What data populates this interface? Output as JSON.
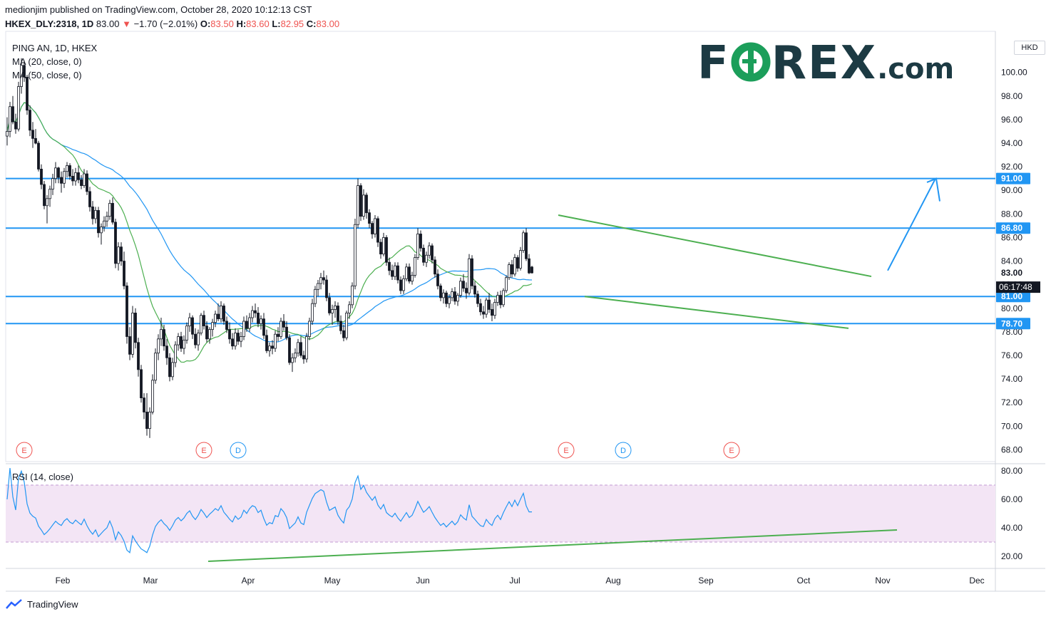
{
  "header": {
    "line1": "medionjim published on TradingView.com, October 28, 2020 10:12:13 CST",
    "symbol": "HKEX_DLY:2318, 1D",
    "price": "83.00",
    "change_arrow": "▼",
    "change": "−1.70 (−2.01%)",
    "o_label": "O:",
    "o_value": "83.50",
    "h_label": "H:",
    "h_value": "83.60",
    "l_label": "L:",
    "l_value": "82.95",
    "c_label": "C:",
    "c_value": "83.00"
  },
  "legend": {
    "title": "PING AN, 1D, HKEX",
    "ma20": "MA (20, close, 0)",
    "ma50": "MA (50, close, 0)",
    "rsi": "RSI (14, close)"
  },
  "logo": {
    "part1": "F",
    "part2": "REX",
    "part3": ".com"
  },
  "currency": "HKD",
  "footer": {
    "brand": "TradingView"
  },
  "colors": {
    "up": "#ffffff",
    "down": "#131722",
    "ma20": "#4caf50",
    "ma50": "#2196f3",
    "hlines": "#2196f3",
    "trend": "#4caf50",
    "rsi": "#2196f3",
    "rsi_band": "#f3e5f5",
    "header_down": "#ef5350",
    "logo": "#1c3a43",
    "logo_o": "#1b9e5a"
  },
  "chart_data": {
    "type": "candlestick",
    "x_ticks": [
      "Feb",
      "Mar",
      "Apr",
      "May",
      "Jun",
      "Jul",
      "Aug",
      "Sep",
      "Oct",
      "Nov",
      "Dec"
    ],
    "y_ticks": [
      "68.00",
      "70.00",
      "72.00",
      "74.00",
      "76.00",
      "78.00",
      "80.00",
      "82.00",
      "84.00",
      "86.00",
      "88.00",
      "90.00",
      "92.00",
      "94.00",
      "96.00",
      "98.00",
      "100.00"
    ],
    "y_range": [
      67,
      103
    ],
    "price_labels": [
      {
        "value": 91.0,
        "text": "91.00",
        "kind": "level"
      },
      {
        "value": 86.8,
        "text": "86.80",
        "kind": "level"
      },
      {
        "value": 83.0,
        "text": "83.00",
        "kind": "last"
      },
      {
        "value": 81.0,
        "text": "81.00",
        "kind": "level"
      },
      {
        "value": 78.7,
        "text": "78.70",
        "kind": "level"
      }
    ],
    "countdown": "06:17:48",
    "horizontal_levels": [
      91.0,
      86.8,
      81.0,
      78.7
    ],
    "events": [
      {
        "label": "E",
        "date_index": 37
      },
      {
        "label": "E",
        "date_index": 100
      },
      {
        "label": "D",
        "date_index": 112
      },
      {
        "label": "E",
        "date_index": 227
      },
      {
        "label": "D",
        "date_index": 247
      },
      {
        "label": "E",
        "date_index": 285
      }
    ],
    "rsi": {
      "y_ticks": [
        "20.00",
        "40.00",
        "60.00",
        "80.00"
      ],
      "y_range": [
        13,
        83
      ],
      "overbought": 70,
      "oversold": 30
    },
    "candles_ohlc_daily": [
      [
        94.6,
        96.2,
        93.8,
        95.0
      ],
      [
        95.0,
        97.5,
        94.5,
        97.1
      ],
      [
        97.1,
        98.0,
        95.6,
        95.8
      ],
      [
        95.8,
        96.5,
        94.8,
        95.2
      ],
      [
        95.2,
        99.2,
        95.0,
        98.8
      ],
      [
        98.8,
        101.2,
        98.2,
        100.6
      ],
      [
        100.6,
        101.0,
        99.2,
        99.6
      ],
      [
        99.6,
        99.8,
        96.4,
        96.8
      ],
      [
        96.8,
        97.2,
        94.6,
        95.1
      ],
      [
        95.1,
        95.8,
        93.6,
        94.4
      ],
      [
        94.4,
        95.2,
        93.9,
        94.0
      ],
      [
        94.0,
        94.2,
        91.6,
        91.8
      ],
      [
        91.8,
        92.2,
        90.1,
        90.5
      ],
      [
        90.5,
        90.8,
        88.4,
        88.7
      ],
      [
        88.7,
        89.6,
        87.2,
        89.3
      ],
      [
        89.3,
        90.4,
        88.6,
        90.1
      ],
      [
        90.1,
        91.4,
        89.6,
        91.0
      ],
      [
        91.0,
        92.4,
        90.6,
        91.9
      ],
      [
        91.9,
        92.0,
        90.6,
        91.1
      ],
      [
        91.1,
        91.6,
        89.8,
        90.6
      ],
      [
        90.6,
        91.9,
        90.2,
        91.6
      ],
      [
        91.6,
        92.4,
        91.1,
        92.1
      ],
      [
        92.1,
        92.3,
        90.9,
        91.2
      ],
      [
        91.2,
        91.8,
        90.4,
        90.8
      ],
      [
        90.8,
        91.9,
        90.4,
        91.5
      ],
      [
        91.5,
        92.1,
        90.6,
        90.9
      ],
      [
        90.9,
        91.3,
        90.1,
        90.4
      ],
      [
        90.4,
        91.8,
        90.2,
        91.4
      ],
      [
        91.4,
        91.7,
        89.6,
        89.9
      ],
      [
        89.9,
        90.3,
        88.2,
        88.6
      ],
      [
        88.6,
        89.1,
        87.1,
        87.6
      ],
      [
        87.6,
        88.6,
        87.2,
        88.3
      ],
      [
        88.3,
        88.6,
        86.0,
        86.4
      ],
      [
        86.4,
        87.2,
        85.4,
        86.9
      ],
      [
        86.9,
        87.8,
        86.5,
        87.4
      ],
      [
        87.4,
        88.2,
        86.9,
        87.8
      ],
      [
        87.8,
        89.2,
        87.5,
        88.9
      ],
      [
        88.9,
        89.4,
        87.1,
        87.3
      ],
      [
        87.3,
        87.6,
        83.4,
        83.8
      ],
      [
        83.8,
        85.6,
        83.2,
        85.2
      ],
      [
        85.2,
        85.6,
        83.6,
        84.0
      ],
      [
        84.0,
        84.8,
        81.6,
        81.9
      ],
      [
        81.9,
        82.2,
        77.0,
        77.6
      ],
      [
        77.6,
        78.4,
        75.6,
        76.1
      ],
      [
        76.1,
        80.2,
        75.8,
        79.6
      ],
      [
        79.6,
        80.0,
        76.6,
        77.1
      ],
      [
        77.1,
        77.5,
        74.2,
        74.8
      ],
      [
        74.8,
        75.2,
        72.0,
        72.4
      ],
      [
        72.4,
        72.8,
        70.6,
        71.2
      ],
      [
        71.2,
        72.8,
        69.2,
        69.8
      ],
      [
        69.8,
        71.6,
        69.0,
        71.2
      ],
      [
        71.2,
        74.4,
        71.0,
        73.9
      ],
      [
        73.9,
        76.6,
        73.6,
        76.2
      ],
      [
        76.2,
        77.8,
        75.6,
        77.4
      ],
      [
        77.4,
        79.2,
        76.8,
        78.2
      ],
      [
        78.2,
        78.6,
        76.4,
        76.8
      ],
      [
        76.8,
        77.4,
        75.2,
        75.8
      ],
      [
        75.8,
        76.2,
        73.8,
        74.2
      ],
      [
        74.2,
        75.8,
        73.9,
        75.4
      ],
      [
        75.4,
        77.2,
        75.0,
        76.9
      ],
      [
        76.9,
        77.9,
        76.4,
        77.6
      ],
      [
        77.6,
        78.0,
        76.3,
        76.6
      ],
      [
        76.6,
        77.7,
        76.1,
        77.3
      ],
      [
        77.3,
        78.8,
        77.0,
        78.5
      ],
      [
        78.5,
        79.6,
        78.0,
        79.2
      ],
      [
        79.2,
        79.4,
        77.4,
        77.8
      ],
      [
        77.8,
        78.3,
        76.6,
        76.9
      ],
      [
        76.9,
        78.2,
        76.4,
        77.9
      ],
      [
        77.9,
        79.6,
        77.7,
        79.4
      ],
      [
        79.4,
        79.8,
        78.2,
        78.5
      ],
      [
        78.5,
        78.9,
        77.1,
        77.4
      ],
      [
        77.4,
        78.4,
        77.0,
        78.2
      ],
      [
        78.2,
        79.1,
        77.6,
        78.8
      ],
      [
        78.8,
        79.8,
        78.4,
        79.5
      ],
      [
        79.5,
        80.4,
        78.9,
        79.1
      ],
      [
        79.1,
        80.6,
        78.8,
        80.2
      ],
      [
        80.2,
        80.4,
        78.6,
        78.9
      ],
      [
        78.9,
        79.3,
        77.9,
        78.2
      ],
      [
        78.2,
        78.8,
        77.0,
        77.4
      ],
      [
        77.4,
        77.9,
        76.5,
        76.8
      ],
      [
        76.8,
        78.3,
        76.5,
        77.9
      ],
      [
        77.9,
        78.2,
        76.9,
        77.2
      ],
      [
        77.2,
        78.0,
        76.7,
        77.6
      ],
      [
        77.6,
        79.3,
        77.3,
        78.9
      ],
      [
        78.9,
        79.4,
        78.0,
        78.3
      ],
      [
        78.3,
        79.6,
        78.0,
        79.2
      ],
      [
        79.2,
        80.2,
        78.8,
        79.8
      ],
      [
        79.8,
        80.4,
        79.2,
        79.6
      ],
      [
        79.6,
        80.1,
        78.4,
        78.7
      ],
      [
        78.7,
        79.4,
        78.2,
        79.1
      ],
      [
        79.1,
        79.6,
        77.4,
        77.7
      ],
      [
        77.7,
        78.2,
        76.2,
        76.4
      ],
      [
        76.4,
        77.1,
        75.9,
        76.8
      ],
      [
        76.8,
        77.3,
        76.1,
        76.6
      ],
      [
        76.6,
        78.1,
        76.3,
        77.8
      ],
      [
        77.8,
        78.4,
        77.2,
        77.6
      ],
      [
        77.6,
        79.2,
        77.4,
        78.9
      ],
      [
        78.9,
        79.5,
        78.1,
        78.4
      ],
      [
        78.4,
        78.9,
        77.3,
        77.5
      ],
      [
        77.5,
        77.8,
        75.2,
        75.4
      ],
      [
        75.4,
        76.2,
        74.6,
        75.8
      ],
      [
        75.8,
        76.6,
        75.4,
        76.2
      ],
      [
        76.2,
        77.4,
        75.9,
        77.1
      ],
      [
        77.1,
        77.6,
        75.8,
        76.0
      ],
      [
        76.0,
        76.4,
        75.3,
        75.7
      ],
      [
        75.7,
        77.9,
        75.4,
        77.6
      ],
      [
        77.6,
        79.2,
        77.3,
        78.9
      ],
      [
        78.9,
        80.8,
        78.6,
        80.4
      ],
      [
        80.4,
        81.9,
        80.1,
        81.6
      ],
      [
        81.6,
        82.4,
        81.0,
        82.1
      ],
      [
        82.1,
        83.0,
        81.6,
        82.6
      ],
      [
        82.6,
        83.2,
        82.0,
        82.4
      ],
      [
        82.4,
        82.8,
        80.6,
        80.9
      ],
      [
        80.9,
        81.3,
        79.4,
        79.6
      ],
      [
        79.6,
        80.3,
        78.6,
        79.9
      ],
      [
        79.9,
        80.6,
        79.2,
        80.2
      ],
      [
        80.2,
        80.5,
        78.6,
        78.9
      ],
      [
        78.9,
        79.4,
        77.8,
        78.1
      ],
      [
        78.1,
        78.6,
        77.2,
        77.5
      ],
      [
        77.5,
        79.8,
        77.3,
        79.6
      ],
      [
        79.6,
        80.6,
        79.1,
        80.3
      ],
      [
        80.3,
        82.2,
        80.0,
        81.9
      ],
      [
        81.9,
        87.6,
        81.6,
        87.1
      ],
      [
        87.1,
        91.0,
        86.8,
        90.4
      ],
      [
        90.4,
        90.6,
        87.4,
        87.8
      ],
      [
        87.8,
        90.1,
        87.5,
        89.6
      ],
      [
        89.6,
        89.8,
        87.6,
        88.1
      ],
      [
        88.1,
        88.4,
        86.8,
        87.2
      ],
      [
        87.2,
        87.4,
        85.9,
        86.3
      ],
      [
        86.3,
        87.9,
        86.0,
        87.6
      ],
      [
        87.6,
        87.8,
        85.2,
        85.6
      ],
      [
        85.6,
        85.9,
        84.2,
        84.6
      ],
      [
        84.6,
        86.4,
        84.4,
        86.0
      ],
      [
        86.0,
        86.2,
        83.6,
        83.9
      ],
      [
        83.9,
        84.3,
        82.8,
        83.2
      ],
      [
        83.2,
        83.7,
        82.4,
        82.7
      ],
      [
        82.7,
        83.9,
        82.4,
        83.6
      ],
      [
        83.6,
        83.9,
        82.1,
        82.4
      ],
      [
        82.4,
        82.7,
        81.2,
        81.5
      ],
      [
        81.5,
        82.8,
        81.2,
        82.5
      ],
      [
        82.5,
        83.8,
        82.3,
        83.5
      ],
      [
        83.5,
        83.8,
        82.1,
        82.3
      ],
      [
        82.3,
        83.1,
        82.0,
        82.8
      ],
      [
        82.8,
        84.6,
        82.6,
        84.3
      ],
      [
        84.3,
        86.8,
        84.1,
        86.3
      ],
      [
        86.3,
        86.6,
        84.8,
        85.1
      ],
      [
        85.1,
        85.4,
        83.6,
        83.9
      ],
      [
        83.9,
        84.8,
        83.5,
        84.5
      ],
      [
        84.5,
        85.6,
        84.2,
        85.3
      ],
      [
        85.3,
        85.5,
        83.8,
        84.1
      ],
      [
        84.1,
        84.4,
        82.6,
        82.9
      ],
      [
        82.9,
        83.3,
        81.6,
        81.9
      ],
      [
        81.9,
        82.1,
        80.6,
        80.9
      ],
      [
        80.9,
        81.6,
        80.4,
        81.3
      ],
      [
        81.3,
        81.5,
        80.1,
        80.4
      ],
      [
        80.4,
        81.2,
        80.0,
        80.9
      ],
      [
        80.9,
        81.7,
        80.6,
        81.4
      ],
      [
        81.4,
        81.8,
        80.3,
        80.6
      ],
      [
        80.6,
        81.3,
        80.2,
        81.1
      ],
      [
        81.1,
        82.6,
        80.9,
        82.3
      ],
      [
        82.3,
        82.9,
        81.4,
        81.7
      ],
      [
        81.7,
        82.2,
        80.8,
        81.3
      ],
      [
        81.3,
        84.6,
        81.1,
        84.2
      ],
      [
        84.2,
        84.5,
        81.6,
        81.9
      ],
      [
        81.9,
        82.3,
        80.9,
        81.2
      ],
      [
        81.2,
        81.5,
        80.1,
        80.4
      ],
      [
        80.4,
        80.8,
        79.4,
        79.7
      ],
      [
        79.7,
        80.2,
        79.1,
        79.5
      ],
      [
        79.5,
        80.9,
        79.2,
        80.7
      ],
      [
        80.7,
        81.3,
        79.6,
        79.9
      ],
      [
        79.9,
        80.4,
        78.9,
        79.4
      ],
      [
        79.4,
        80.8,
        79.1,
        80.5
      ],
      [
        80.5,
        81.4,
        80.2,
        81.1
      ],
      [
        81.1,
        81.5,
        80.0,
        80.3
      ],
      [
        80.3,
        81.7,
        80.1,
        81.5
      ],
      [
        81.5,
        82.8,
        81.3,
        82.6
      ],
      [
        82.6,
        83.9,
        82.4,
        83.7
      ],
      [
        83.7,
        84.1,
        82.6,
        82.9
      ],
      [
        82.9,
        84.6,
        82.7,
        84.3
      ],
      [
        84.3,
        84.5,
        83.1,
        83.4
      ],
      [
        83.4,
        85.2,
        83.2,
        84.9
      ],
      [
        84.9,
        86.6,
        84.7,
        86.4
      ],
      [
        86.4,
        86.8,
        84.0,
        84.2
      ],
      [
        84.2,
        84.6,
        82.9,
        83.0
      ],
      [
        83.5,
        83.6,
        82.95,
        83.0
      ]
    ]
  }
}
